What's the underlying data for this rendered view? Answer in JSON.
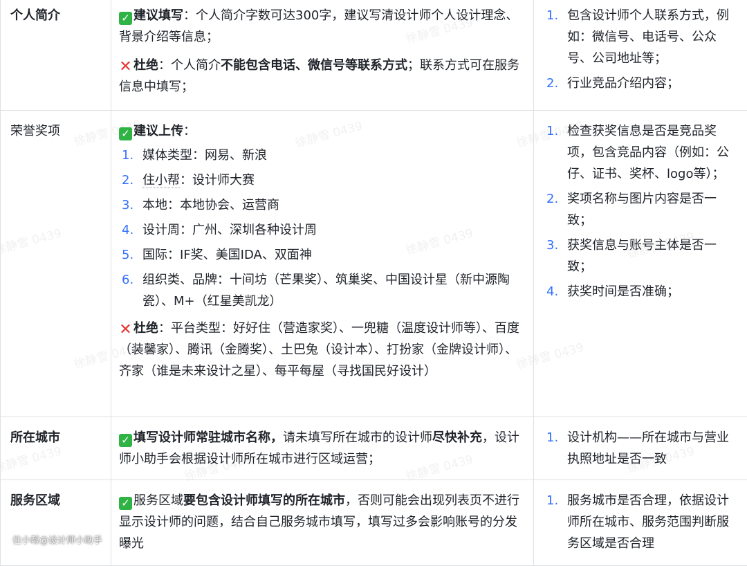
{
  "rows": [
    {
      "label": "个人简介",
      "middle": {
        "ok_prefix": "建议填写",
        "ok_text": "：个人简介字数可达300字，建议写清设计师个人设计理念、背景介绍等信息；",
        "no_prefix": "杜绝",
        "no_text_a": "：个人简介",
        "no_text_bold": "不能包含电话、微信号等联系方式",
        "no_text_b": "；联系方式可在服务信息中填写；"
      },
      "checks": [
        {
          "n": "1.",
          "t": "包含设计师个人联系方式，例如：微信号、电话号、公众号、公司地址等；"
        },
        {
          "n": "2.",
          "t": "行业竞品介绍内容；"
        }
      ]
    },
    {
      "label": "荣誉奖项",
      "middle": {
        "ok_prefix": "建议上传",
        "ok_text": "：",
        "items": [
          {
            "n": "1.",
            "t": "媒体类型：网易、新浪"
          },
          {
            "n": "2.",
            "t_a": "住小帮",
            "t_b": "：设计师大赛"
          },
          {
            "n": "3.",
            "t": "本地：本地协会、运营商"
          },
          {
            "n": "4.",
            "t": "设计周：广州、深圳各种设计周"
          },
          {
            "n": "5.",
            "t": "国际：IF奖、美国IDA、双面神"
          },
          {
            "n": "6.",
            "t": "组织类、品牌：十间坊（芒果奖）、筑巢奖、中国设计星（新中源陶瓷）、M+（红星美凯龙）"
          }
        ],
        "no_prefix": "杜绝",
        "no_text": "：平台类型：好好住（营造家奖）、一兜糖（温度设计师等）、百度（装馨家）、腾讯（金腾奖）、土巴兔（设计本）、打扮家（金牌设计师）、齐家（谁是未来设计之星）、每平每屋（寻找国民好设计）"
      },
      "checks": [
        {
          "n": "1.",
          "t": "检查获奖信息是否是竞品奖项，包含竞品内容（例如：公仔、证书、奖杯、logo等）；"
        },
        {
          "n": "2.",
          "t": "奖项名称与图片内容是否一致；"
        },
        {
          "n": "3.",
          "t": "获奖信息与账号主体是否一致；"
        },
        {
          "n": "4.",
          "t": "获奖时间是否准确；"
        }
      ]
    },
    {
      "label": "所在城市",
      "middle": {
        "ok_bold": "填写设计师常驻城市名称，",
        "text_a": "请未填写所在城市的设计师",
        "text_bold": "尽快补充",
        "text_b": "，设计师小助手会根据设计师所在城市进行区域运营；"
      },
      "checks": [
        {
          "n": "1.",
          "t": "设计机构——所在城市与营业执照地址是否一致"
        }
      ]
    },
    {
      "label": "服务区域",
      "middle": {
        "text_a": "服务区域",
        "text_bold": "要包含设计师填写的所在城市",
        "text_b": "，否则可能会出现列表页不进行显示设计师的问题，结合自己服务城市填写，填写过多会影响账号的分发曝光"
      },
      "checks": [
        {
          "n": "1.",
          "t": "服务城市是否合理，依据设计师所在城市、服务范围判断服务区域是否合理"
        }
      ]
    }
  ],
  "watermark": "徐静雪 0439",
  "credit": "住小帮@设计师小助手",
  "icons": {
    "ok": "✓",
    "no": "✕"
  }
}
